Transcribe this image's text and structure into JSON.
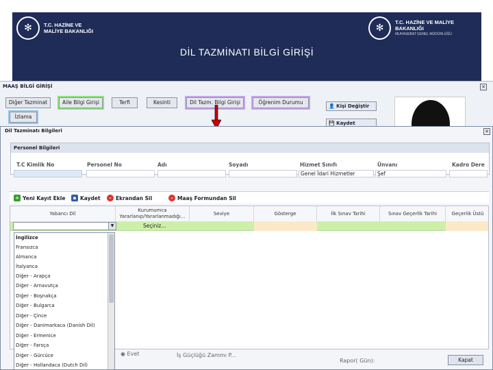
{
  "header": {
    "left_logo_line1": "T.C. HAZİNE VE",
    "left_logo_line2": "MALİYE BAKANLIĞI",
    "right_logo_line1": "T.C. HAZİNE VE MALİYE BAKANLIĞI",
    "right_logo_line2": "MUHASEBAT GENEL MÜDÜRLÜĞÜ",
    "title": "DİL TAZMİNATI BİLGİ GİRİŞİ"
  },
  "maas": {
    "title": "MAAŞ BİLGİ GİRİŞİ",
    "tabs": [
      "Diğer Tazminat",
      "Aile Bilgi Girişi",
      "Terfi",
      "Kesinti",
      "Dil Tazm. Bilgi Girişi",
      "Öğrenim Durumu"
    ],
    "izin_tab": "İzlama",
    "side_buttons": [
      "Kişi Değiştir",
      "Kaydet"
    ]
  },
  "dil": {
    "title": "Dil Tazminatı Bilgileri",
    "personel_title": "Personel Bilgileri",
    "personel_headers": [
      "T.C Kimlik No",
      "Personel No",
      "Adı",
      "Soyadı",
      "Hizmet Sınıfı",
      "Ünvanı",
      "Kadro Dere"
    ],
    "personel_values": {
      "hizmet": "Genel İdari Hizmetler",
      "unvan": "Şef"
    },
    "toolbar": [
      "Yeni Kayıt Ekle",
      "Kaydet",
      "Ekrandan Sil",
      "Maaş Formundan Sil"
    ],
    "grid_headers": [
      "Yabancı Dil",
      "Kurumumca Yararlanıp/Yararlanmadığı...",
      "Seviye",
      "Gösterge",
      "İlk Sınav Tarihi",
      "Sınav Geçerlik Tarihi",
      "Geçerlik Üstü"
    ],
    "seciniz": "Seçiniz...",
    "dropdown": [
      "İngilizce",
      "Fransızca",
      "Almanca",
      "İtalyanca",
      "Diğer - Arapça",
      "Diğer - Arnavutça",
      "Diğer - Boşnakça",
      "Diğer - Bulgarca",
      "Diğer - Çince",
      "Diğer - Danimarkaca (Danish Dil)",
      "Diğer - Ermenice",
      "Diğer - Farsça",
      "Diğer - Gürcüce",
      "Diğer - Hollandaca (Dutch Dil)"
    ]
  },
  "bottom": {
    "evet": "Evet",
    "gucluk": "İş Güçlüğü Zammı P...",
    "rapor": "Rapor( Gün):",
    "kapat": "Kapat"
  }
}
